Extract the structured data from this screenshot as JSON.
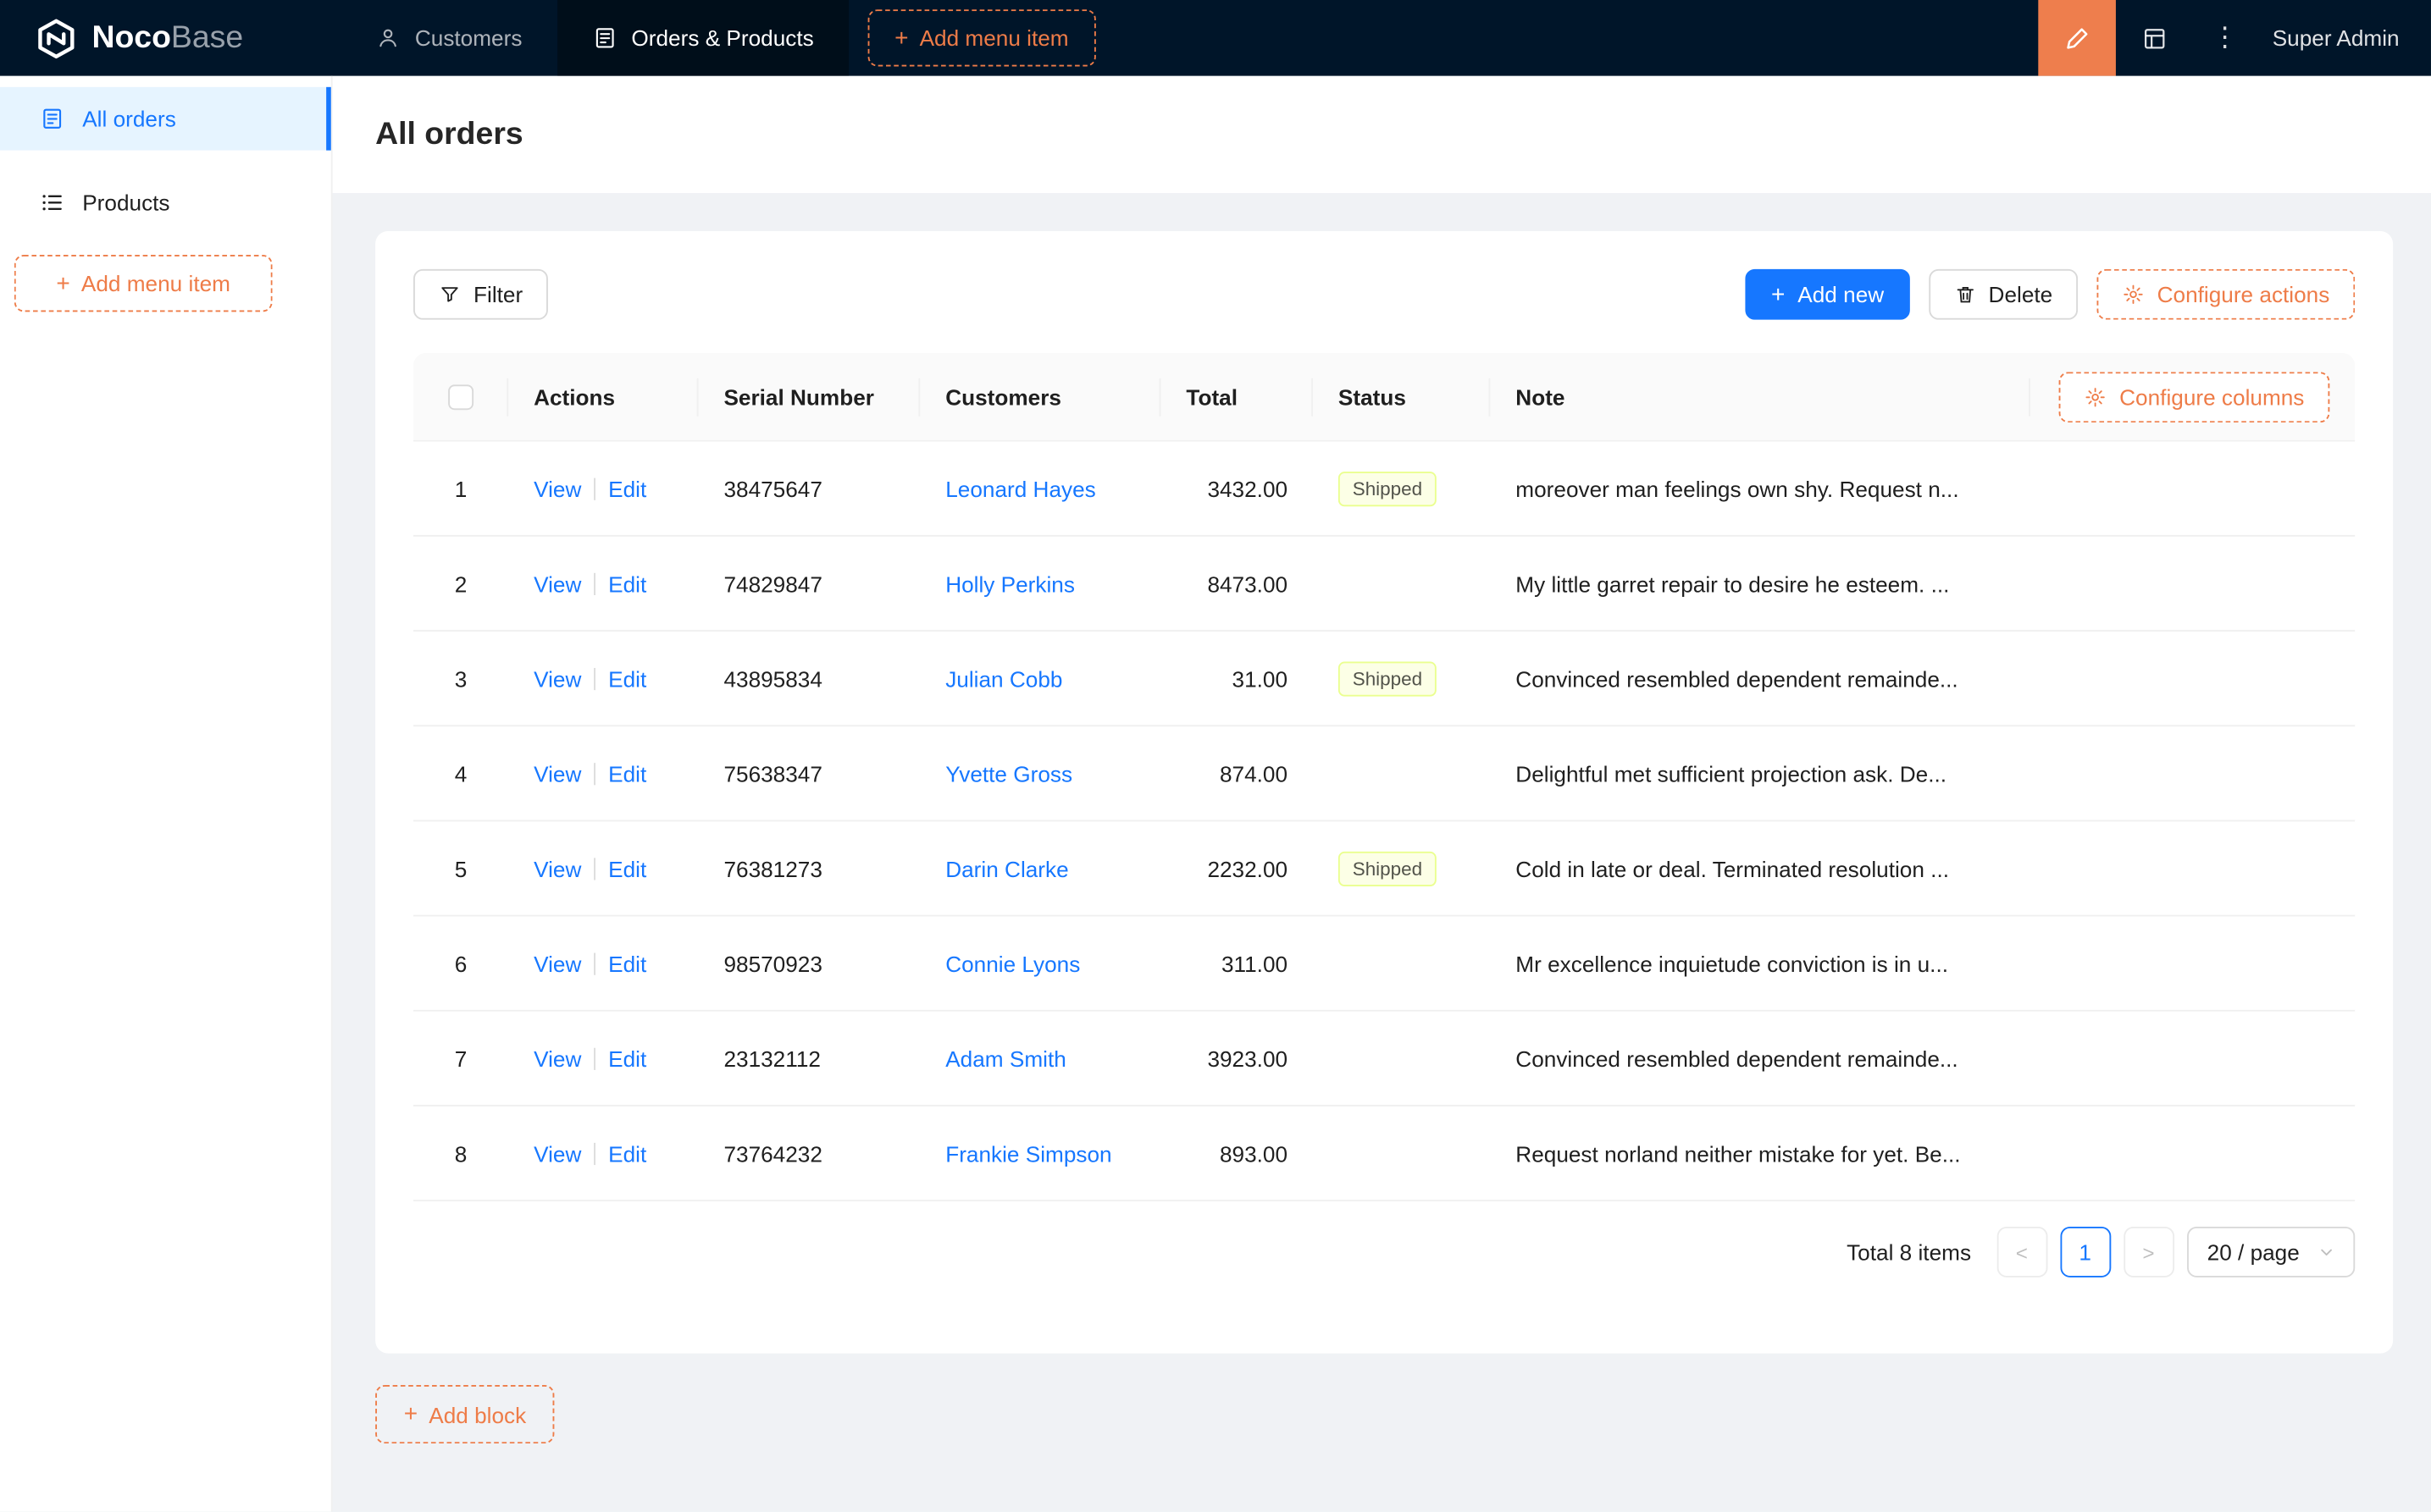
{
  "icons": {
    "plus": "+",
    "kebab": "⋮",
    "chevron_left": "<",
    "chevron_right": ">"
  },
  "header": {
    "logo_noco": "Noco",
    "logo_base": "Base",
    "nav": [
      {
        "label": "Customers"
      },
      {
        "label": "Orders & Products"
      }
    ],
    "add_menu_item_label": "Add menu item",
    "user_name": "Super Admin"
  },
  "sidebar": {
    "items": [
      {
        "label": "All orders"
      },
      {
        "label": "Products"
      }
    ],
    "add_menu_item_label": "Add menu item"
  },
  "page": {
    "title": "All orders",
    "filter_label": "Filter",
    "add_new_label": "Add new",
    "delete_label": "Delete",
    "configure_actions_label": "Configure actions",
    "configure_columns_label": "Configure columns",
    "add_block_label": "Add block"
  },
  "table": {
    "columns": {
      "actions": "Actions",
      "serial": "Serial Number",
      "customers": "Customers",
      "total": "Total",
      "status": "Status",
      "note": "Note"
    },
    "action_view": "View",
    "action_edit": "Edit",
    "shipped_label": "Shipped",
    "rows": [
      {
        "index": 1,
        "serial": "38475647",
        "customer": "Leonard Hayes",
        "total": "3432.00",
        "status": "Shipped",
        "note": "moreover man feelings own shy. Request n..."
      },
      {
        "index": 2,
        "serial": "74829847",
        "customer": "Holly Perkins",
        "total": "8473.00",
        "status": "",
        "note": "My little garret repair to desire he esteem. ..."
      },
      {
        "index": 3,
        "serial": "43895834",
        "customer": "Julian Cobb",
        "total": "31.00",
        "status": "Shipped",
        "note": "Convinced resembled dependent remainde..."
      },
      {
        "index": 4,
        "serial": "75638347",
        "customer": "Yvette Gross",
        "total": "874.00",
        "status": "",
        "note": "Delightful met sufficient projection ask. De..."
      },
      {
        "index": 5,
        "serial": "76381273",
        "customer": "Darin Clarke",
        "total": "2232.00",
        "status": "Shipped",
        "note": "Cold in late or deal. Terminated resolution ..."
      },
      {
        "index": 6,
        "serial": "98570923",
        "customer": "Connie Lyons",
        "total": "311.00",
        "status": "",
        "note": "Mr excellence inquietude conviction is in u..."
      },
      {
        "index": 7,
        "serial": "23132112",
        "customer": "Adam Smith",
        "total": "3923.00",
        "status": "",
        "note": "Convinced resembled dependent remainde..."
      },
      {
        "index": 8,
        "serial": "73764232",
        "customer": "Frankie Simpson",
        "total": "893.00",
        "status": "",
        "note": "Request norland neither mistake for yet. Be..."
      }
    ]
  },
  "pagination": {
    "total_text": "Total 8 items",
    "current_page": "1",
    "page_size": "20 / page"
  },
  "colors": {
    "accent_orange": "#ee7c48",
    "primary_blue": "#1677ff",
    "header_bg": "#001529",
    "active_sidebar_bg": "#e6f4ff",
    "shipped_tag_bg": "#fcffe6",
    "shipped_tag_border": "#eaff8f"
  }
}
